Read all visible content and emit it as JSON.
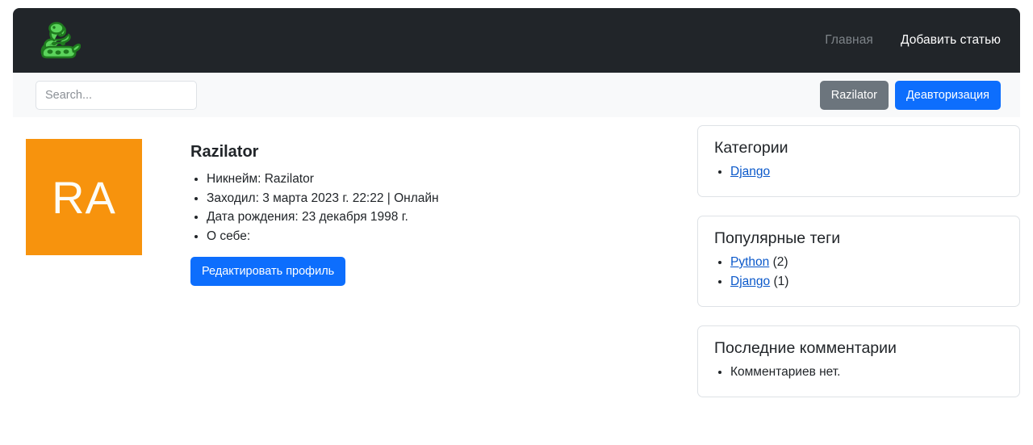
{
  "navbar": {
    "logo_icon": "python-snake-logo-icon",
    "links": [
      {
        "label": "Главная",
        "state": "muted"
      },
      {
        "label": "Добавить статью",
        "state": "active"
      }
    ]
  },
  "subbar": {
    "search": {
      "placeholder": "Search...",
      "value": ""
    },
    "user_button": "Razilator",
    "logout_button": "Деавторизация"
  },
  "profile": {
    "avatar_initials": "RA",
    "avatar_color": "#f7930d",
    "name": "Razilator",
    "details": [
      "Никнейм: Razilator",
      "Заходил: 3 марта 2023 г. 22:22 | Онлайн",
      "Дата рождения: 23 декабря 1998 г.",
      "О себе:"
    ],
    "edit_button": "Редактировать профиль"
  },
  "sidebar": {
    "categories": {
      "title": "Категории",
      "items": [
        {
          "label": "Django"
        }
      ]
    },
    "tags": {
      "title": "Популярные теги",
      "items": [
        {
          "label": "Python",
          "count": "(2)"
        },
        {
          "label": "Django",
          "count": "(1)"
        }
      ]
    },
    "comments": {
      "title": "Последние комментарии",
      "items": [
        {
          "label": "Комментариев нет."
        }
      ]
    }
  },
  "colors": {
    "navbar_bg": "#212529",
    "subbar_bg": "#f8f9fa",
    "primary": "#0d6efd",
    "secondary": "#6c757d",
    "link": "#0a58ca",
    "border": "#dee2e6"
  }
}
